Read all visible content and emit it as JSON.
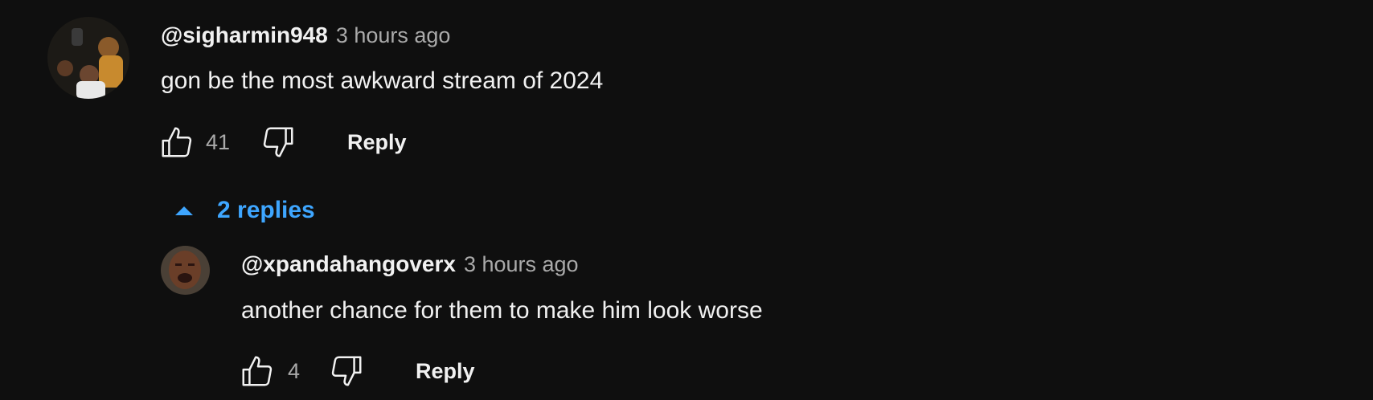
{
  "colors": {
    "background": "#0f0f0f",
    "text": "#f1f1f1",
    "muted": "#aaaaaa",
    "link": "#3ea6ff"
  },
  "comment": {
    "author": "@sigharmin948",
    "time": "3 hours ago",
    "text": "gon be the most awkward stream of 2024",
    "likes": "41",
    "reply_label": "Reply",
    "avatar_icon": "user-avatar"
  },
  "replies_toggle": {
    "label": "2 replies",
    "icon": "caret-up-icon"
  },
  "reply": {
    "author": "@xpandahangoverx",
    "time": "3 hours ago",
    "text": "another chance for them to make him look worse",
    "likes": "4",
    "reply_label": "Reply",
    "avatar_icon": "user-avatar"
  }
}
